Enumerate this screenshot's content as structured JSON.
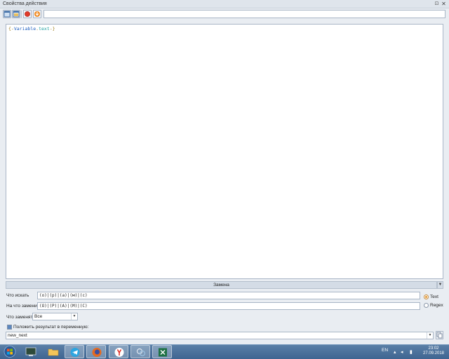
{
  "window": {
    "title": "Свойства действия",
    "pin_glyph": "⊡",
    "close_glyph": "✕"
  },
  "toolbar": {
    "buttons": [
      "layout-single-icon",
      "layout-split-icon",
      "record-icon",
      "download-icon"
    ],
    "input_value": ""
  },
  "editor": {
    "code_open": "{-",
    "code_var": "Variable",
    "code_dot": ".",
    "code_prop": "text",
    "code_close": "-}"
  },
  "replace": {
    "header_label": "Замена",
    "find_label": "Что искать",
    "find_value": "(о)|(р)|(а)|(м)|(с)",
    "replace_label": "На что заменить",
    "replace_value": "(O)|(P)|(A)|(M)|(C)",
    "mode_text_label": "Text",
    "mode_regex_label": "Regex",
    "mode_selected": "Text",
    "what_label": "Что заменять",
    "what_value": "Все",
    "result_checkbox_label": "Положить результат в переменную:",
    "result_checked": true,
    "variable_value": "new_next"
  },
  "taskbar": {
    "apps": [
      "start-icon",
      "terminal-icon",
      "folder-icon",
      "telegram-icon",
      "firefox-icon",
      "yandex-icon",
      "app-icon",
      "excel-icon"
    ],
    "language": "EN",
    "time": "23:02",
    "date": "27.09.2018"
  }
}
